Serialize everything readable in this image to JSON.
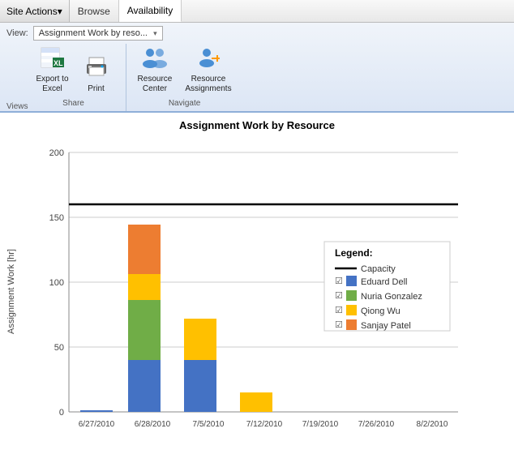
{
  "topnav": {
    "site_actions": "Site Actions",
    "browse": "Browse",
    "availability": "Availability"
  },
  "ribbon": {
    "view_label": "View:",
    "view_value": "Assignment Work by reso...",
    "groups": [
      {
        "label": "Share",
        "items": [
          {
            "id": "export-to-excel",
            "icon": "📊",
            "label": "Export to\nExcel"
          },
          {
            "id": "print",
            "icon": "🖨",
            "label": "Print"
          }
        ]
      },
      {
        "label": "Navigate",
        "items": [
          {
            "id": "resource-center",
            "icon": "👥",
            "label": "Resource\nCenter"
          },
          {
            "id": "resource-assignments",
            "icon": "👤",
            "label": "Resource\nAssignments"
          }
        ]
      }
    ],
    "views_label": "Views"
  },
  "chart": {
    "title": "Assignment Work by Resource",
    "y_axis_label": "Assignment Work [hr]",
    "y_max": 200,
    "y_ticks": [
      0,
      50,
      100,
      150,
      200
    ],
    "capacity_line": 160,
    "x_labels": [
      "6/27/2010",
      "6/28/2010",
      "7/5/2010",
      "7/12/2010",
      "7/19/2010",
      "7/26/2010",
      "8/2/2010"
    ],
    "bars": [
      {
        "x_label": "6/27/2010",
        "segments": [
          {
            "color": "#4472C4",
            "value": 1
          }
        ]
      },
      {
        "x_label": "6/28/2010",
        "segments": [
          {
            "color": "#4472C4",
            "value": 40
          },
          {
            "color": "#70AD47",
            "value": 46
          },
          {
            "color": "#FFC000",
            "value": 20
          },
          {
            "color": "#ED7D31",
            "value": 38
          }
        ]
      },
      {
        "x_label": "7/5/2010",
        "segments": [
          {
            "color": "#4472C4",
            "value": 40
          },
          {
            "color": "#FFC000",
            "value": 32
          }
        ]
      },
      {
        "x_label": "7/12/2010",
        "segments": [
          {
            "color": "#FFC000",
            "value": 15
          }
        ]
      },
      {
        "x_label": "7/19/2010",
        "segments": []
      },
      {
        "x_label": "7/26/2010",
        "segments": []
      },
      {
        "x_label": "8/2/2010",
        "segments": []
      }
    ],
    "legend": {
      "title": "Legend:",
      "capacity_label": "Capacity",
      "items": [
        {
          "name": "Eduard Dell",
          "color": "#4472C4"
        },
        {
          "name": "Nuria Gonzalez",
          "color": "#70AD47"
        },
        {
          "name": "Qiong Wu",
          "color": "#FFC000"
        },
        {
          "name": "Sanjay Patel",
          "color": "#ED7D31"
        }
      ]
    }
  }
}
